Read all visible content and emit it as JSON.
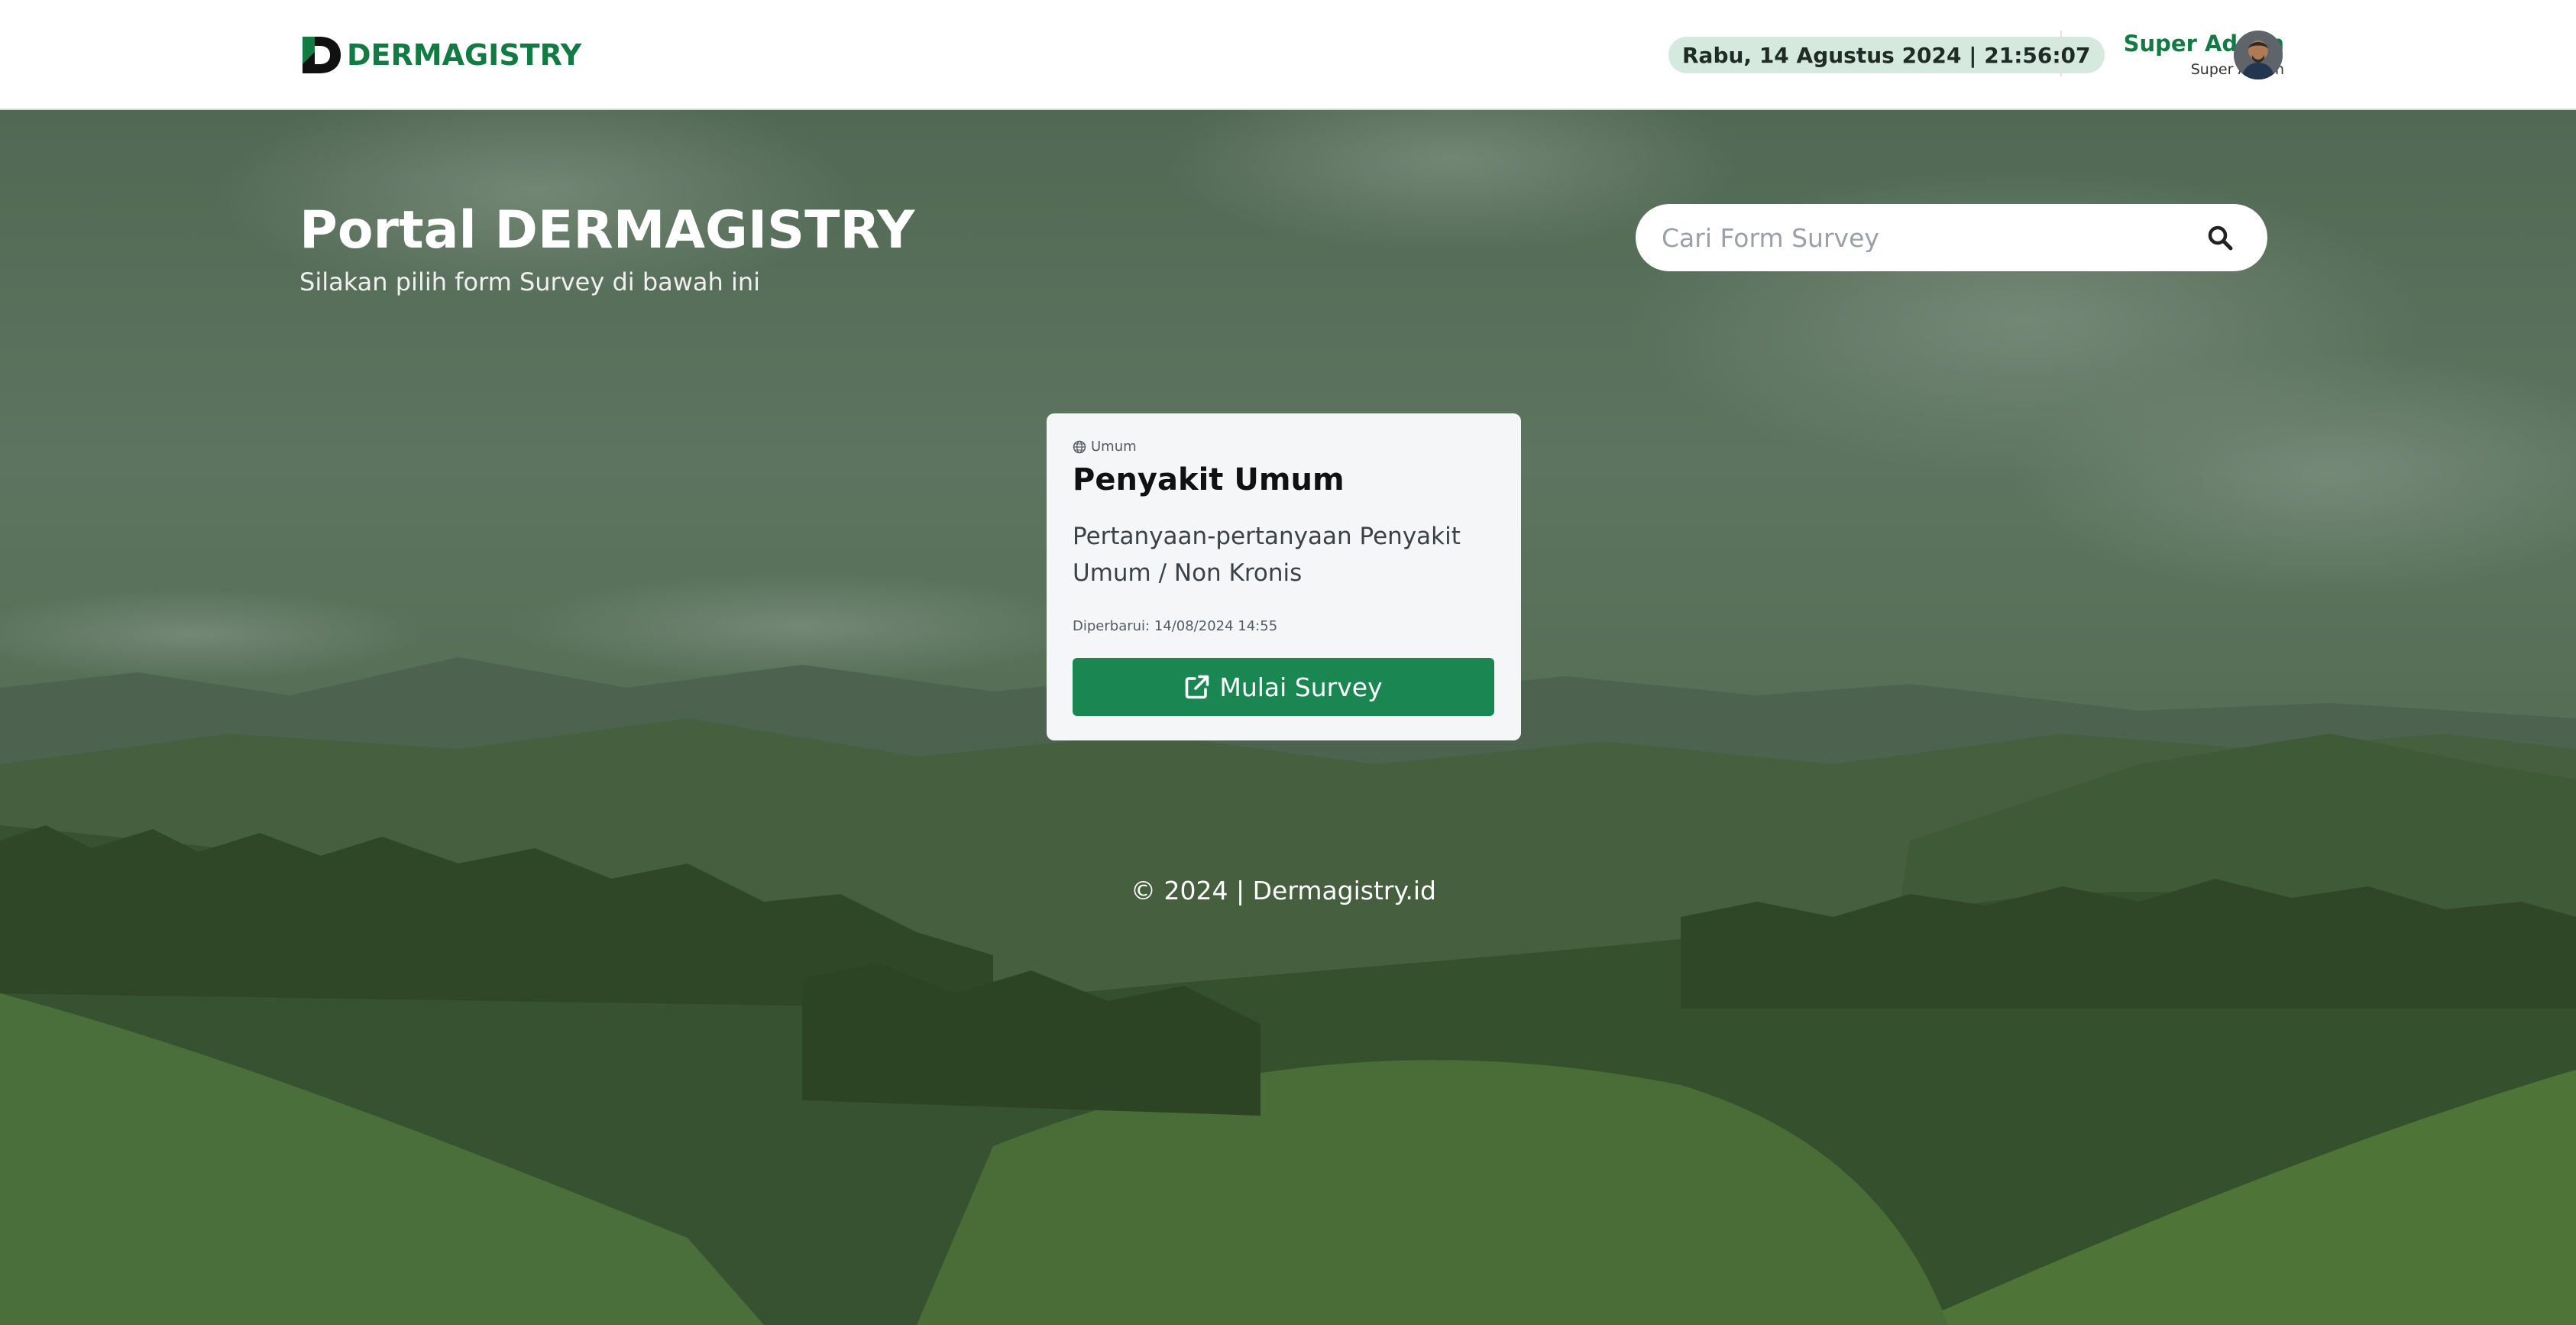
{
  "brand": {
    "name": "DERMAGISTRY",
    "color": "#137a43"
  },
  "header": {
    "datetime": "Rabu, 14 Agustus 2024 | 21:56:07",
    "user_name": "Super Admin",
    "user_role": "Super Admin"
  },
  "hero": {
    "title": "Portal DERMAGISTRY",
    "subtitle": "Silakan pilih form Survey di bawah ini"
  },
  "search": {
    "placeholder": "Cari Form Survey",
    "value": ""
  },
  "survey_cards": [
    {
      "category": "Umum",
      "title": "Penyakit Umum",
      "description": "Pertanyaan-pertanyaan Penyakit Umum / Non Kronis",
      "updated": "Diperbarui:  14/08/2024 14:55",
      "button_label": "Mulai Survey",
      "button_color": "#1a8752"
    }
  ],
  "footer": {
    "text": "© 2024 | Dermagistry.id"
  },
  "icons": {
    "search": "search-icon",
    "category": "globe-icon",
    "start": "external-link-icon"
  }
}
